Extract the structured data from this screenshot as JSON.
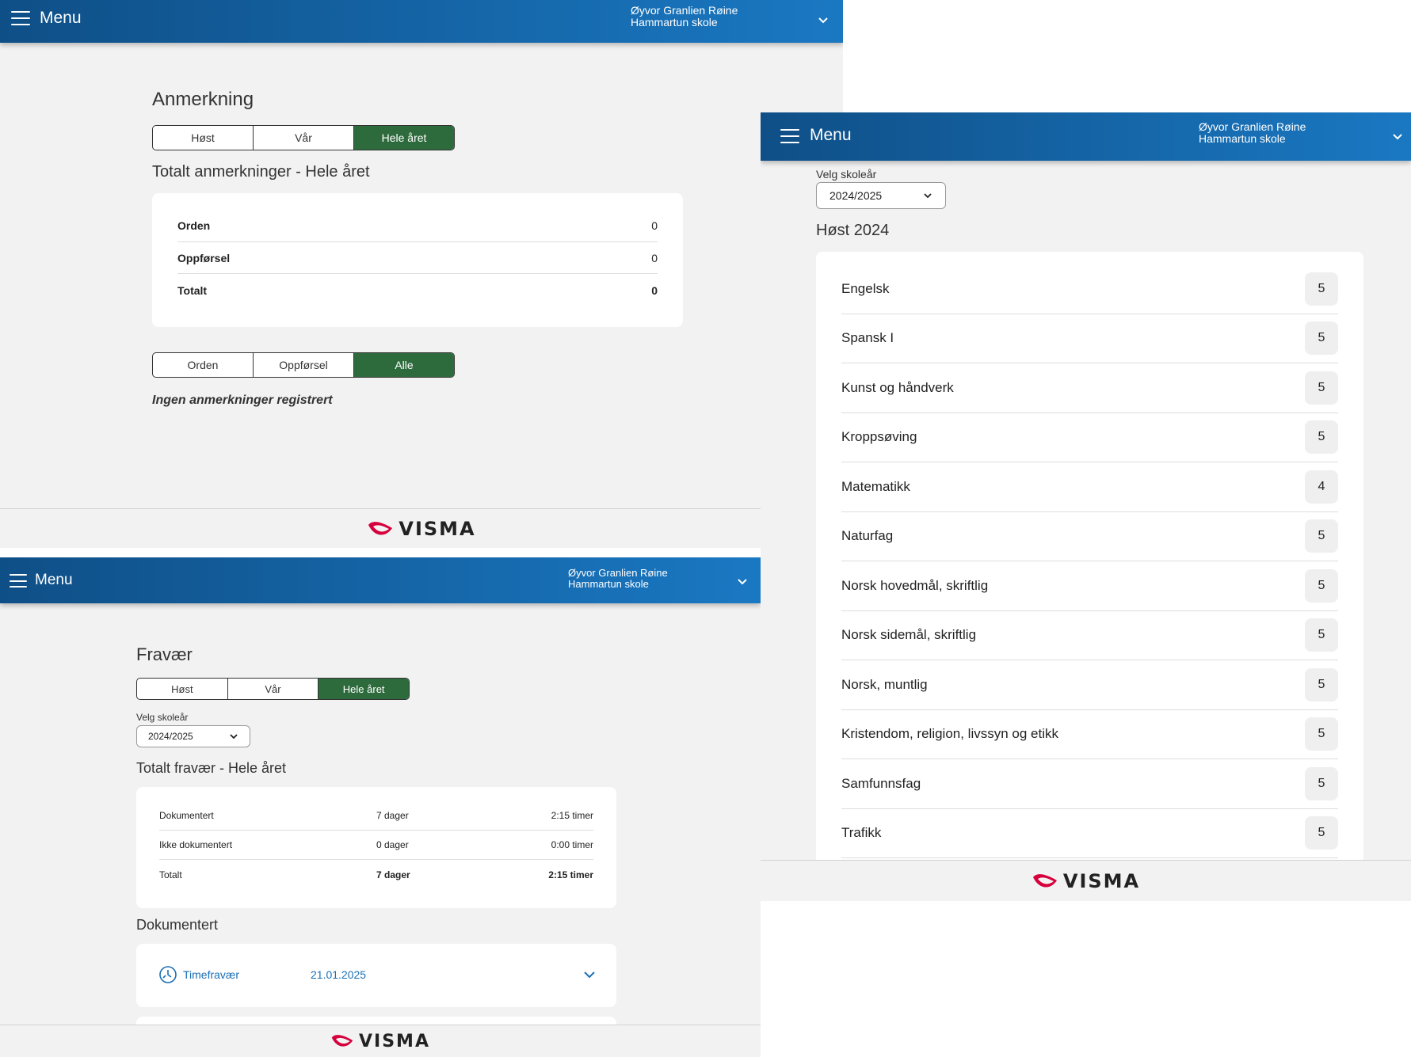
{
  "header": {
    "menu_label": "Menu",
    "user_name": "Øyvor Granlien Røine",
    "school": "Hammartun skole"
  },
  "logo_text": "VISMA",
  "colors": {
    "header_start": "#0f4f87",
    "header_end": "#1a78c2",
    "active_segment": "#2e6b3c",
    "link": "#1a6fb5",
    "logo_red": "#d6003c"
  },
  "anmerkning": {
    "title": "Anmerkning",
    "period_tabs": [
      "Høst",
      "Vår",
      "Hele året"
    ],
    "active_period": "Hele året",
    "summary_title": "Totalt anmerkninger - Hele året",
    "summary_rows": [
      {
        "label": "Orden",
        "value": "0"
      },
      {
        "label": "Oppførsel",
        "value": "0"
      },
      {
        "label": "Totalt",
        "value": "0"
      }
    ],
    "filter_tabs": [
      "Orden",
      "Oppførsel",
      "Alle"
    ],
    "active_filter": "Alle",
    "empty_text": "Ingen anmerkninger registrert"
  },
  "fravaer": {
    "title": "Fravær",
    "period_tabs": [
      "Høst",
      "Vår",
      "Hele året"
    ],
    "active_period": "Hele året",
    "year_label": "Velg skoleår",
    "year_value": "2024/2025",
    "summary_title": "Totalt fravær - Hele året",
    "summary_rows": [
      {
        "label": "Dokumentert",
        "days": "7 dager",
        "hours": "2:15 timer"
      },
      {
        "label": "Ikke dokumentert",
        "days": "0 dager",
        "hours": "0:00 timer"
      },
      {
        "label": "Totalt",
        "days": "7 dager",
        "hours": "2:15 timer"
      }
    ],
    "documented_title": "Dokumentert",
    "entries": [
      {
        "type": "Timefravær",
        "date": "21.01.2025",
        "icon": "clock-icon"
      }
    ]
  },
  "grades": {
    "year_label": "Velg skoleår",
    "year_value": "2024/2025",
    "term_title": "Høst 2024",
    "subjects": [
      {
        "name": "Engelsk",
        "grade": "5"
      },
      {
        "name": "Spansk I",
        "grade": "5"
      },
      {
        "name": "Kunst og håndverk",
        "grade": "5"
      },
      {
        "name": "Kroppsøving",
        "grade": "5"
      },
      {
        "name": "Matematikk",
        "grade": "4"
      },
      {
        "name": "Naturfag",
        "grade": "5"
      },
      {
        "name": "Norsk hovedmål, skriftlig",
        "grade": "5"
      },
      {
        "name": "Norsk sidemål, skriftlig",
        "grade": "5"
      },
      {
        "name": "Norsk, muntlig",
        "grade": "5"
      },
      {
        "name": "Kristendom, religion, livssyn og etikk",
        "grade": "5"
      },
      {
        "name": "Samfunnsfag",
        "grade": "5"
      },
      {
        "name": "Trafikk",
        "grade": "5"
      }
    ]
  }
}
